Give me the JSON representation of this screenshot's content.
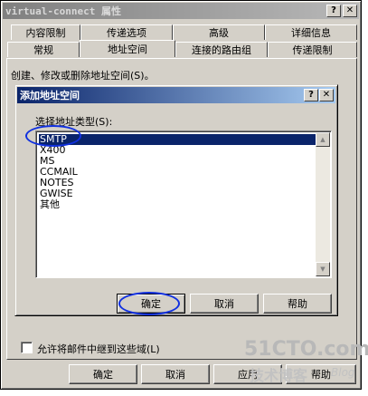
{
  "outer_dialog": {
    "title": "virtual-connect 属性",
    "help_button": "?",
    "close_button": "✕"
  },
  "tabs_row1": [
    {
      "label": "内容限制"
    },
    {
      "label": "传递选项"
    },
    {
      "label": "高级"
    },
    {
      "label": "详细信息"
    }
  ],
  "tabs_row2": [
    {
      "label": "常规"
    },
    {
      "label": "地址空间"
    },
    {
      "label": "连接的路由组"
    },
    {
      "label": "传递限制"
    }
  ],
  "panel": {
    "description": "创建、修改或删除地址空间(S)。",
    "relay_checkbox_label": "允许将邮件中继到这些域(L)",
    "relay_checked": false
  },
  "inner_dialog": {
    "title": "添加地址空间",
    "help_button": "?",
    "close_button": "✕",
    "list_label": "选择地址类型(S):",
    "address_types": [
      "SMTP",
      "X400",
      "MS",
      "CCMAIL",
      "NOTES",
      "GWISE",
      "其他"
    ],
    "selected_type": "SMTP",
    "ok_button": "确定",
    "cancel_button": "取消",
    "help_text_button": "帮助"
  },
  "bottom_buttons": {
    "ok": "确定",
    "cancel": "取消",
    "apply": "应用",
    "help": "帮助"
  },
  "watermark": {
    "line1": "51CTO.com",
    "line2": "技术博客",
    "line3": "Blog"
  },
  "colors": {
    "dialog_face": "#d4d0c8",
    "active_title": "#0a246a",
    "selection": "#0a246a",
    "annotation": "#1030e0"
  }
}
